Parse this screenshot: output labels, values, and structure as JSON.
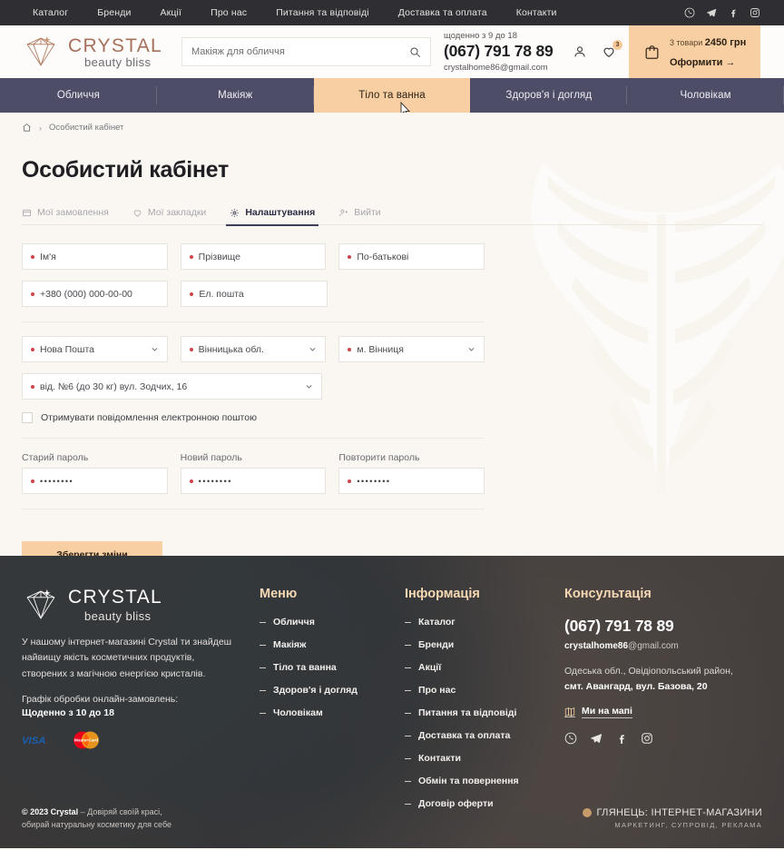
{
  "topbar": {
    "nav": [
      "Каталог",
      "Бренди",
      "Акції",
      "Про нас",
      "Питання та відповіді",
      "Доставка та оплата",
      "Контакти"
    ],
    "social": [
      "viber-icon",
      "telegram-icon",
      "facebook-icon",
      "instagram-icon"
    ]
  },
  "header": {
    "logo_line1": "CRYSTAL",
    "logo_line2": "beauty bliss",
    "search_placeholder": "Макіяж для обличчя",
    "search_value": "",
    "hours": "щоденно з 9 до 18",
    "phone": "(067) 791 78 89",
    "email": "crystalhome86@gmail.com",
    "wishlist_badge": "3",
    "cart_count": "3 товари",
    "cart_total": "2450 грн",
    "cart_link": "Оформити  →"
  },
  "mainnav": {
    "items": [
      {
        "label": "Обличчя",
        "active": false
      },
      {
        "label": "Макіяж",
        "active": false
      },
      {
        "label": "Тіло та ванна",
        "active": true
      },
      {
        "label": "Здоров'я і догляд",
        "active": false
      },
      {
        "label": "Чоловікам",
        "active": false
      }
    ]
  },
  "breadcrumb": {
    "home_icon": "home-icon",
    "separator": "›",
    "current": "Особистий кабінет"
  },
  "page": {
    "title": "Особистий кабінет",
    "tabs": [
      {
        "label": "Мої замовлення",
        "icon": "orders-icon",
        "active": false
      },
      {
        "label": "Мої закладки",
        "icon": "heart-icon",
        "active": false
      },
      {
        "label": "Налаштування",
        "icon": "gear-icon",
        "active": true
      },
      {
        "label": "Вийти",
        "icon": "logout-icon",
        "active": false
      }
    ]
  },
  "form": {
    "first_name": "Ім'я",
    "last_name": "Прізвище",
    "middle_name": "По-батькові",
    "phone": "+380 (000) 000-00-00",
    "email": "Ел. пошта",
    "carrier": "Нова Пошта",
    "region": "Вінницька обл.",
    "city": "м. Вінниця",
    "branch": "від. №6 (до 30 кг) вул. Зодчих, 16",
    "newsletter_label": "Отримувати повідомлення електронною поштою",
    "old_password_label": "Старий пароль",
    "new_password_label": "Новий пароль",
    "repeat_password_label": "Повторити пароль",
    "old_password_value": "••••••••",
    "new_password_value": "••••••••",
    "repeat_password_value": "••••••••",
    "save_label": "Зберегти зміни"
  },
  "footer": {
    "logo_line1": "CRYSTAL",
    "logo_line2": "beauty bliss",
    "description": "У нашому інтернет-магазині Crystal ти знайдеш найвищу якість косметичних продуктів, створених з магічною енергією кристалів.",
    "schedule_label": "Графік обробки онлайн-замовлень:",
    "schedule_value": "Щоденно з 10 до 18",
    "payments": [
      "visa-logo",
      "mastercard-logo"
    ],
    "menu_title": "Меню",
    "menu_items": [
      "Обличчя",
      "Макіяж",
      "Тіло та ванна",
      "Здоров'я і догляд",
      "Чоловікам"
    ],
    "info_title": "Інформація",
    "info_items": [
      "Каталог",
      "Бренди",
      "Акції",
      "Про нас",
      "Питання та відповіді",
      "Доставка та оплата",
      "Контакти",
      "Обмін та повернення",
      "Договір оферти"
    ],
    "consult_title": "Консультація",
    "phone": "(067) 791 78 89",
    "email_user": "crystalhome86",
    "email_domain": "@gmail.com",
    "address_line1": "Одеська обл., Овідіопольський район,",
    "address_line2": "смт. Авангард, вул. Базова, 20",
    "map_label": "Ми на мапі",
    "social": [
      "viber-icon",
      "telegram-icon",
      "facebook-icon",
      "instagram-icon"
    ],
    "copyright_strong": "© 2023 Crystal",
    "copyright_rest": " – Довіряй своїй красі,",
    "copyright_line2": "обирай натуральну косметику для себе",
    "dev_title": "ГЛЯНЕЦЬ: ІНТЕРНЕТ-МАГАЗИНИ",
    "dev_sub": "МАРКЕТИНГ, СУПРОВІД, РЕКЛАМА"
  },
  "colors": {
    "accent": "#f8cfa2",
    "navy": "#4d4d68",
    "dark": "#2f2f33",
    "brand_brown": "#a6705a",
    "required": "#d0434b",
    "footer_title": "#f6d9b4"
  }
}
